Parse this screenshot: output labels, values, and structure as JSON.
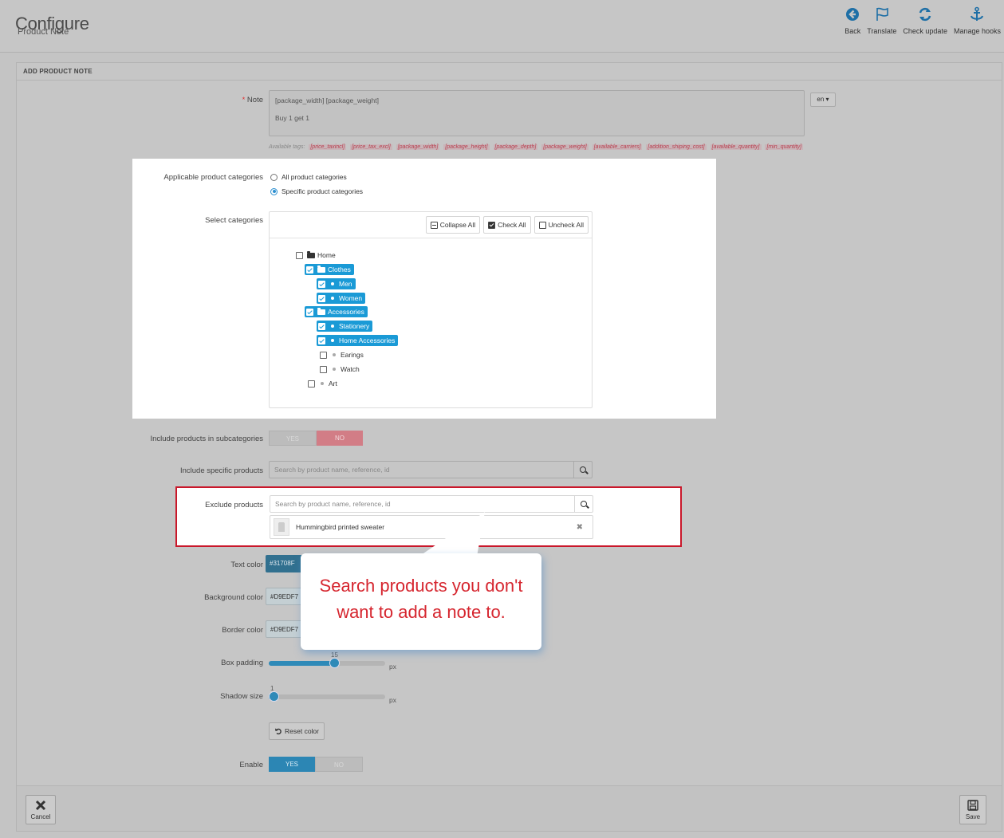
{
  "header": {
    "title": "Configure",
    "breadcrumb": "Product Note",
    "toolbar": [
      {
        "label": "Back",
        "icon": "back-circle-icon"
      },
      {
        "label": "Translate",
        "icon": "flag-icon"
      },
      {
        "label": "Check update",
        "icon": "refresh-icon"
      },
      {
        "label": "Manage hooks",
        "icon": "anchor-icon"
      }
    ]
  },
  "panel": {
    "heading": "ADD PRODUCT NOTE"
  },
  "note": {
    "required_mark": "*",
    "label": "Note",
    "lines": [
      "[package_width] [package_weight]",
      "Buy 1 get 1"
    ],
    "language": "en ▾",
    "tags_label": "Available tags:",
    "tags": [
      "[price_taxincl]",
      "[price_tax_excl]",
      "[package_width]",
      "[package_height]",
      "[package_depth]",
      "[package_weight]",
      "[available_carriers]",
      "[addition_shiping_cost]",
      "[available_quantity]",
      "[min_quantity]"
    ]
  },
  "categories": {
    "applicable_label": "Applicable product categories",
    "option_all": "All product categories",
    "option_specific": "Specific product categories",
    "selected_option": "specific",
    "select_label": "Select categories",
    "buttons": {
      "collapse": "Collapse All",
      "check": "Check All",
      "uncheck": "Uncheck All"
    },
    "tree": [
      {
        "label": "Home",
        "checked": false,
        "folder": true
      },
      {
        "label": "Clothes",
        "checked": true,
        "folder": true
      },
      {
        "label": "Men",
        "checked": true,
        "folder": false
      },
      {
        "label": "Women",
        "checked": true,
        "folder": false
      },
      {
        "label": "Accessories",
        "checked": true,
        "folder": true
      },
      {
        "label": "Stationery",
        "checked": true,
        "folder": false
      },
      {
        "label": "Home Accessories",
        "checked": true,
        "folder": false
      },
      {
        "label": "Earings",
        "checked": false,
        "folder": false
      },
      {
        "label": "Watch",
        "checked": false,
        "folder": false
      },
      {
        "label": "Art",
        "checked": false,
        "folder": false
      }
    ]
  },
  "subcategories": {
    "label": "Include products in subcategories",
    "yes": "YES",
    "no": "NO",
    "value": "NO"
  },
  "include_products": {
    "label": "Include specific products",
    "placeholder": "Search by product name, reference, id"
  },
  "exclude_products": {
    "label": "Exclude products",
    "placeholder": "Search by product name, reference, id",
    "items": [
      "Hummingbird printed sweater"
    ]
  },
  "colors": {
    "text_label": "Text color",
    "text_value": "#31708F",
    "background_label": "Background color",
    "background_value": "#D9EDF7",
    "border_label": "Border color",
    "border_value": "#D9EDF7"
  },
  "box_padding": {
    "label": "Box padding",
    "value": "15",
    "unit": "px",
    "fraction": 0.56
  },
  "shadow_size": {
    "label": "Shadow size",
    "value": "1",
    "unit": "px",
    "fraction": 0.02
  },
  "reset_label": "Reset color",
  "enable": {
    "label": "Enable",
    "yes": "YES",
    "no": "NO",
    "value": "YES"
  },
  "footer": {
    "cancel": "Cancel",
    "save": "Save"
  },
  "callout": {
    "line1": "Search products you don't",
    "line2": "want to add a note to."
  }
}
